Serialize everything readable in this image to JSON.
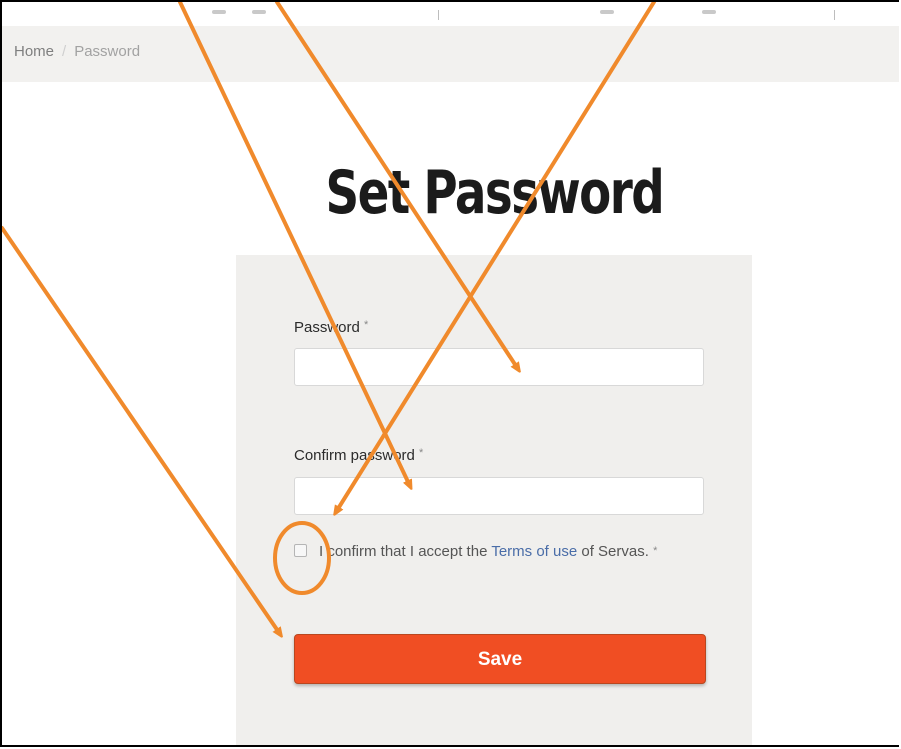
{
  "breadcrumb": {
    "home": "Home",
    "separator": "/",
    "current": "Password"
  },
  "title": "Set Password",
  "form": {
    "password_label": "Password",
    "password_value": "",
    "confirm_label": "Confirm password",
    "confirm_value": "",
    "required_mark": "*",
    "terms_prefix": "I confirm that I accept the ",
    "terms_link": "Terms of use",
    "terms_suffix": " of Servas.",
    "save_label": "Save"
  },
  "colors": {
    "accent": "#f04e23",
    "annotation": "#f08a2c",
    "panel": "#f0efed",
    "link": "#4a6da8"
  }
}
